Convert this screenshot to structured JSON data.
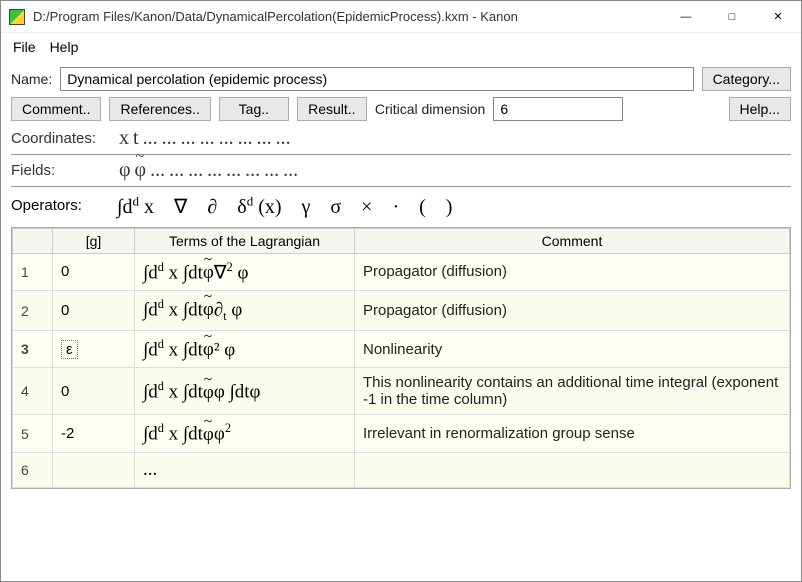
{
  "window": {
    "title": "D:/Program Files/Kanon/Data/DynamicalPercolation(EpidemicProcess).kxm - Kanon"
  },
  "menu": {
    "file": "File",
    "help": "Help"
  },
  "labels": {
    "name": "Name:",
    "category": "Category...",
    "comment": "Comment..",
    "references": "References..",
    "tag": "Tag..",
    "result": "Result..",
    "critdim": "Critical dimension",
    "help": "Help...",
    "coordinates": "Coordinates:",
    "fields": "Fields:",
    "operators": "Operators:"
  },
  "name_value": "Dynamical percolation (epidemic process)",
  "critdim_value": "6",
  "coordinates": [
    "x",
    "t",
    "...",
    "...",
    "...",
    "...",
    "...",
    "...",
    "...",
    "..."
  ],
  "fields": [
    "φ",
    "φ̃",
    "...",
    "...",
    "...",
    "...",
    "...",
    "...",
    "...",
    "..."
  ],
  "operators": [
    "∫dᵈ x",
    "∇",
    "∂",
    "δᵈ (x)",
    "γ",
    "σ",
    "×",
    "·",
    "(",
    ")"
  ],
  "table": {
    "headers": {
      "idx": "",
      "g": "[g]",
      "term": "Terms of the Lagrangian",
      "comment": "Comment"
    },
    "rows": [
      {
        "idx": "1",
        "g": "0",
        "term": "∫dᵈ x ∫dtφ̃∇² φ",
        "comment": "Propagator (diffusion)"
      },
      {
        "idx": "2",
        "g": "0",
        "term": "∫dᵈ x ∫dtφ̃∂ₜ φ",
        "comment": "Propagator (diffusion)"
      },
      {
        "idx": "3",
        "g": "ε",
        "term": "∫dᵈ x ∫dtφ̃² φ",
        "comment": "Nonlinearity",
        "bold": true,
        "boxed": true
      },
      {
        "idx": "4",
        "g": "0",
        "term": "∫dᵈ x ∫dtφ̃φ ∫dtφ",
        "comment": "This nonlinearity contains an additional time integral (exponent -1 in the time column)"
      },
      {
        "idx": "5",
        "g": "-2",
        "term": "∫dᵈ x ∫dtφ̃φ²",
        "comment": "Irrelevant in renormalization group sense"
      },
      {
        "idx": "6",
        "g": "",
        "term": "...",
        "comment": ""
      }
    ]
  }
}
